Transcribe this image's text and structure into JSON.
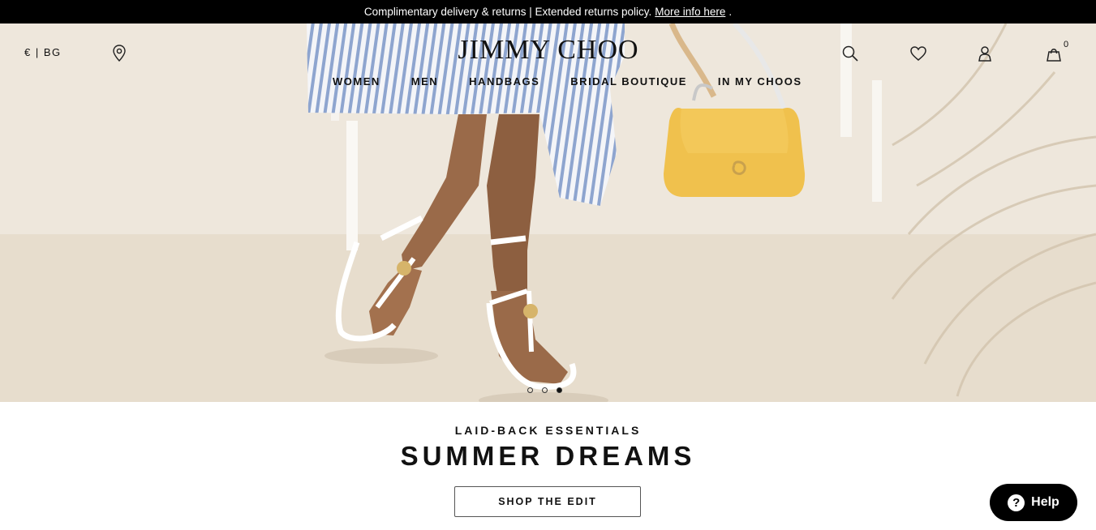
{
  "promo": {
    "text": "Complimentary delivery & returns | Extended returns policy.",
    "link": "More info here",
    "period": "."
  },
  "header": {
    "currency": "€ | BG",
    "logo": "JIMMY CHOO",
    "bag_count": "0",
    "nav": [
      "WOMEN",
      "MEN",
      "HANDBAGS",
      "BRIDAL BOUTIQUE",
      "IN MY CHOOS"
    ],
    "icons": [
      "location-pin-icon",
      "search-icon",
      "heart-icon",
      "user-icon",
      "shopping-bag-icon"
    ]
  },
  "hero": {
    "slides": 3,
    "active_slide": 3
  },
  "content": {
    "subtitle": "LAID-BACK ESSENTIALS",
    "title": "SUMMER DREAMS",
    "cta": "SHOP THE EDIT"
  },
  "help": {
    "label": "Help"
  },
  "colors": {
    "promo_bg": "#000000",
    "accent_bag": "#f0c14d",
    "sand": "#e6dccd"
  }
}
